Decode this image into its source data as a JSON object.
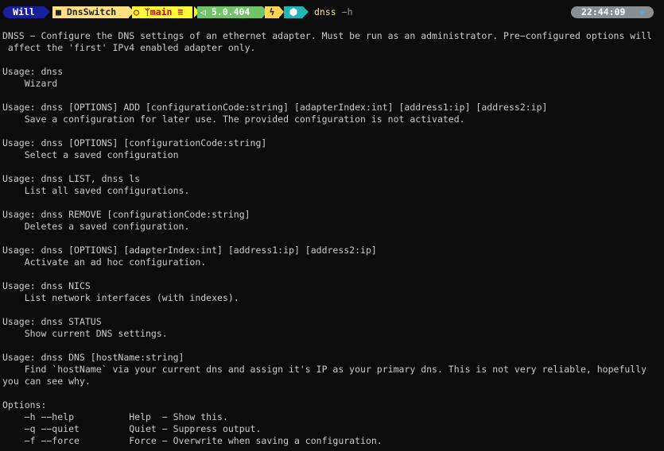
{
  "prompt": {
    "user": "Will",
    "folder_icon": "folder-icon",
    "folder": "DnsSwitch",
    "git_icon": "github-icon",
    "branch_icon": "branch-icon",
    "branch": "main",
    "branch_status": "≡",
    "dotnet_icon": "dotnet-icon",
    "dotnet_version": "5.0.404",
    "bolt_icon": "bolt-icon",
    "node_icon": "node-icon",
    "command": "dnss",
    "command_flag": "−h",
    "time": "22:44:09",
    "clock_icon": "clock-icon"
  },
  "colors": {
    "background": "#0c0c0c",
    "text": "#cccccc",
    "user_bg": "#1a1f9e",
    "path_bg": "#ffe082",
    "git_bg": "#fffb38",
    "dotnet_bg": "#72c268",
    "node_bg": "#23b5b5",
    "clock_bg": "#8a8f93"
  },
  "output_lines": [
    "DNSS − Configure the DNS settings of an ethernet adapter. Must be run as an administrator. Pre−configured options will",
    " affect the 'first' IPv4 enabled adapter only.",
    "",
    "Usage: dnss",
    "    Wizard",
    "",
    "Usage: dnss [OPTIONS] ADD [configurationCode:string] [adapterIndex:int] [address1:ip] [address2:ip]",
    "    Save a configuration for later use. The provided configuration is not activated.",
    "",
    "Usage: dnss [OPTIONS] [configurationCode:string]",
    "    Select a saved configuration",
    "",
    "Usage: dnss LIST, dnss ls",
    "    List all saved configurations.",
    "",
    "Usage: dnss REMOVE [configurationCode:string]",
    "    Deletes a saved configuration.",
    "",
    "Usage: dnss [OPTIONS] [adapterIndex:int] [address1:ip] [address2:ip]",
    "    Activate an ad hoc configuration.",
    "",
    "Usage: dnss NICS",
    "    List network interfaces (with indexes).",
    "",
    "Usage: dnss STATUS",
    "    Show current DNS settings.",
    "",
    "Usage: dnss DNS [hostName:string]",
    "    Find `hostName` via your current dns and assign it's IP as your primary dns. This is not very reliable, hopefully",
    "you can see why.",
    "",
    "Options:",
    "    −h −−help          Help  − Show this.",
    "    −q −−quiet         Quiet − Suppress output.",
    "    −f −−force         Force − Overwrite when saving a configuration."
  ]
}
